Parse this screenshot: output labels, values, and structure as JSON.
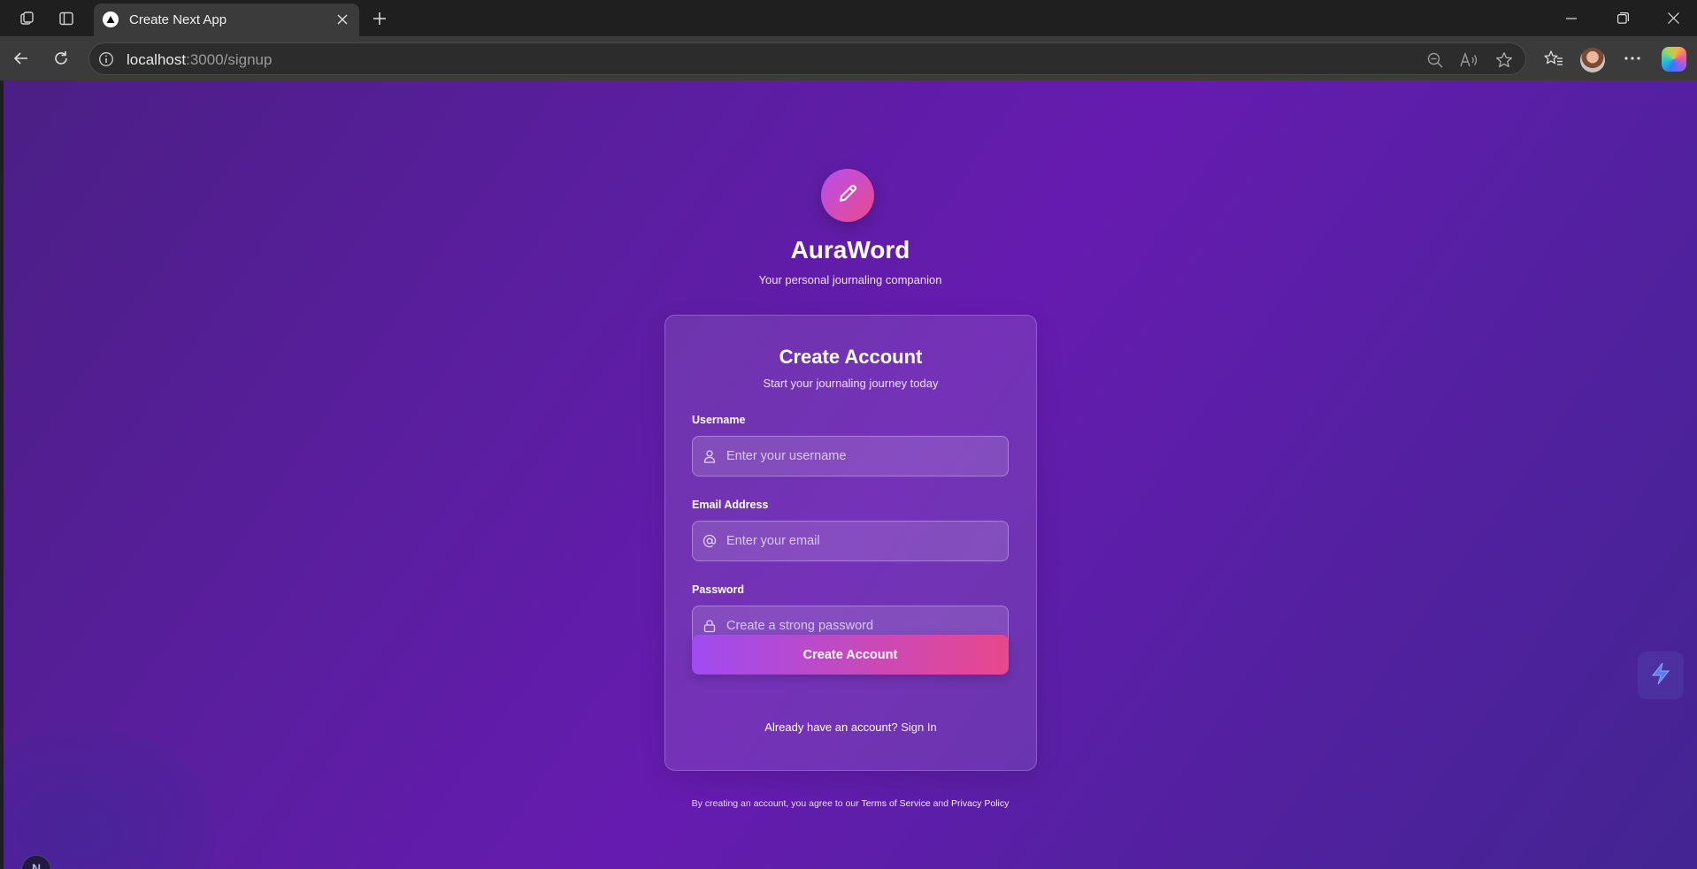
{
  "browser": {
    "tab_title": "Create Next App",
    "url_host": "localhost",
    "url_rest": ":3000/signup"
  },
  "app": {
    "name": "AuraWord",
    "tagline": "Your personal journaling companion"
  },
  "card": {
    "title": "Create Account",
    "subtitle": "Start your journaling journey today",
    "fields": {
      "username": {
        "label": "Username",
        "placeholder": "Enter your username",
        "value": ""
      },
      "email": {
        "label": "Email Address",
        "placeholder": "Enter your email",
        "value": ""
      },
      "password": {
        "label": "Password",
        "placeholder": "Create a strong password",
        "value": ""
      }
    },
    "submit_label": "Create Account",
    "signin_prompt": "Already have an account?",
    "signin_link": "Sign In"
  },
  "footer": {
    "prefix": "By creating an account, you agree to our",
    "terms": "Terms of Service",
    "and": "and",
    "privacy": "Privacy Policy"
  },
  "next_badge": "N",
  "colors": {
    "accent_start": "#a04bf2",
    "accent_end": "#e8488c",
    "background": "#5a1e9f"
  }
}
